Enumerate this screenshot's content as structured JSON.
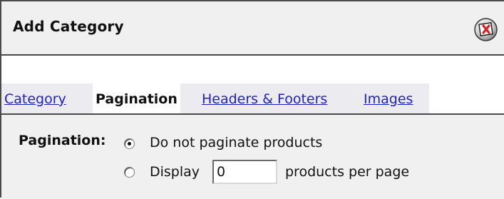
{
  "dialog": {
    "title": "Add Category",
    "close_icon": "close-window-icon"
  },
  "tabs": [
    {
      "label": "Category",
      "active": false
    },
    {
      "label": "Pagination",
      "active": true
    },
    {
      "label": "Headers & Footers",
      "active": false
    },
    {
      "label": "Images",
      "active": false
    }
  ],
  "pagination": {
    "label": "Pagination:",
    "options": [
      {
        "label": "Do not paginate products",
        "selected": true
      },
      {
        "label_before": "Display",
        "label_after": "products per page",
        "selected": false
      }
    ],
    "per_page_value": "0"
  },
  "colors": {
    "link": "#1f1fc8",
    "panel_bg": "#f0f0f0",
    "border": "#4a4a4a"
  }
}
